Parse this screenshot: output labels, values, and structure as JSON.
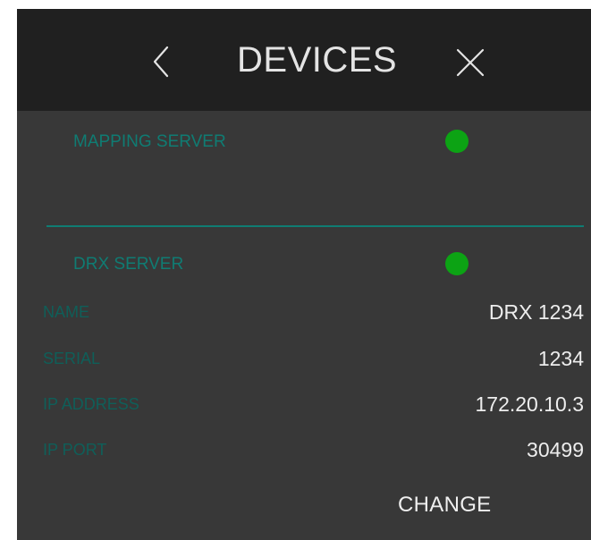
{
  "header": {
    "title": "DEVICES",
    "back_icon": "chevron-left-icon",
    "close_icon": "close-icon"
  },
  "mapping_server": {
    "label": "MAPPING SERVER",
    "status_color": "#0ca314"
  },
  "drx_server": {
    "label": "DRX SERVER",
    "status_color": "#0ca314",
    "fields": [
      {
        "label": "NAME",
        "value": "DRX 1234"
      },
      {
        "label": "SERIAL",
        "value": "1234"
      },
      {
        "label": "IP ADDRESS",
        "value": "172.20.10.3"
      },
      {
        "label": "IP PORT",
        "value": "30499"
      }
    ]
  },
  "actions": {
    "change_label": "CHANGE"
  },
  "colors": {
    "header_bg": "#202020",
    "panel_bg": "#383838",
    "accent_teal": "#0f7c73",
    "status_green": "#0ca314"
  }
}
